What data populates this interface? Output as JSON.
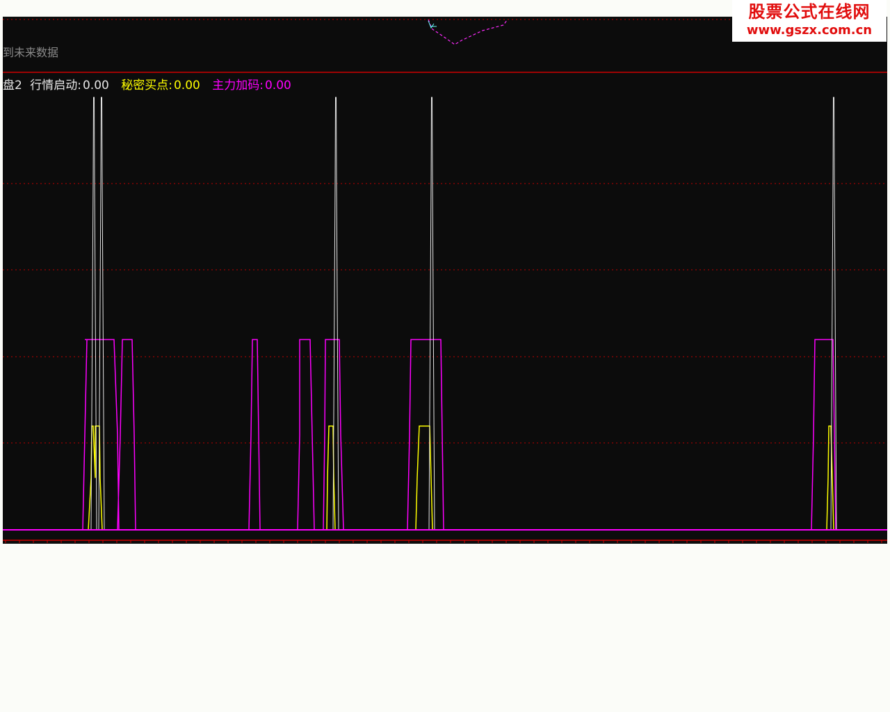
{
  "header": {
    "top_text": "到未来数据",
    "indicator_name": "盘2",
    "legend": [
      {
        "label": "行情启动:",
        "value": "0.00",
        "color": "#e8e8e8"
      },
      {
        "label": "秘密买点:",
        "value": "0.00",
        "color": "#ffff00"
      },
      {
        "label": "主力加码:",
        "value": "0.00",
        "color": "#ff00ff"
      }
    ]
  },
  "watermark": {
    "title": "股票公式在线网",
    "url": "www.gszx.com.cn"
  },
  "colors": {
    "background": "#0c0c0c",
    "grid": "#c00000",
    "separator": "#d00000",
    "white_series": "#e8e8e8",
    "yellow_series": "#ffff00",
    "magenta_series": "#ff00ff"
  },
  "chart_data": {
    "type": "line",
    "x": [
      0,
      20
    ],
    "xrange": [
      0,
      1272
    ],
    "ylim": [
      0,
      5
    ],
    "grid": true,
    "series": [
      {
        "id": "magenta",
        "color": "#ff00ff",
        "points": [
          [
            0,
            0
          ],
          [
            115,
            0
          ],
          [
            121,
            2.2
          ],
          [
            121,
            2.2
          ],
          [
            125,
            2.2
          ],
          [
            118,
            2.2
          ],
          [
            123,
            2.2
          ],
          [
            160,
            2.2
          ],
          [
            165,
            1.1
          ],
          [
            167,
            0
          ],
          [
            190,
            0
          ],
          [
            165,
            0
          ],
          [
            169,
            1.1
          ],
          [
            172,
            2.2
          ],
          [
            186,
            2.2
          ],
          [
            189,
            1.1
          ],
          [
            191,
            0
          ],
          [
            354,
            0
          ],
          [
            357,
            1.1
          ],
          [
            359,
            2.2
          ],
          [
            366,
            2.2
          ],
          [
            368,
            1.1
          ],
          [
            370,
            0
          ],
          [
            424,
            0
          ],
          [
            427,
            1.1
          ],
          [
            427,
            2.2
          ],
          [
            442,
            2.2
          ],
          [
            445,
            1.1
          ],
          [
            448,
            0
          ],
          [
            461,
            0
          ],
          [
            463,
            1.1
          ],
          [
            464,
            2.2
          ],
          [
            484,
            2.2
          ],
          [
            486,
            1.1
          ],
          [
            490,
            0
          ],
          [
            582,
            0
          ],
          [
            585,
            1.1
          ],
          [
            587,
            2.2
          ],
          [
            630,
            2.2
          ],
          [
            632,
            1.1
          ],
          [
            634,
            0
          ],
          [
            1163,
            0
          ],
          [
            1166,
            1.1
          ],
          [
            1168,
            2.2
          ],
          [
            1194,
            2.2
          ],
          [
            1196,
            1.1
          ],
          [
            1198,
            0
          ],
          [
            1272,
            0
          ]
        ]
      },
      {
        "id": "yellow",
        "color": "#ffff00",
        "points": [
          [
            115,
            0
          ],
          [
            123,
            0
          ],
          [
            127,
            0.6
          ],
          [
            128,
            1.2
          ],
          [
            130,
            1.2
          ],
          [
            133,
            0.6
          ],
          [
            133,
            1.2
          ],
          [
            139,
            1.2
          ],
          [
            140,
            0.6
          ],
          [
            143,
            0
          ],
          [
            165,
            0
          ],
          [
            359,
            0
          ],
          [
            371,
            0
          ],
          [
            460,
            0
          ],
          [
            466,
            0
          ],
          [
            467,
            0.6
          ],
          [
            469,
            1.2
          ],
          [
            475,
            1.2
          ],
          [
            476,
            0.6
          ],
          [
            478,
            0
          ],
          [
            488,
            0
          ],
          [
            590,
            0
          ],
          [
            594,
            0
          ],
          [
            596,
            0.6
          ],
          [
            599,
            1.2
          ],
          [
            614,
            1.2
          ],
          [
            616,
            0.6
          ],
          [
            618,
            0
          ],
          [
            634,
            0
          ],
          [
            1185,
            0
          ],
          [
            1187,
            0.6
          ],
          [
            1188,
            1.2
          ],
          [
            1191,
            1.2
          ],
          [
            1193,
            0.6
          ],
          [
            1195,
            0
          ]
        ]
      },
      {
        "id": "white",
        "color": "#e8e8e8",
        "spikes": [
          {
            "x": 131,
            "peak": 5
          },
          {
            "x": 142,
            "peak": 5
          },
          {
            "x": 479,
            "peak": 5
          },
          {
            "x": 617,
            "peak": 5
          },
          {
            "x": 1195,
            "peak": 5
          }
        ]
      }
    ]
  }
}
